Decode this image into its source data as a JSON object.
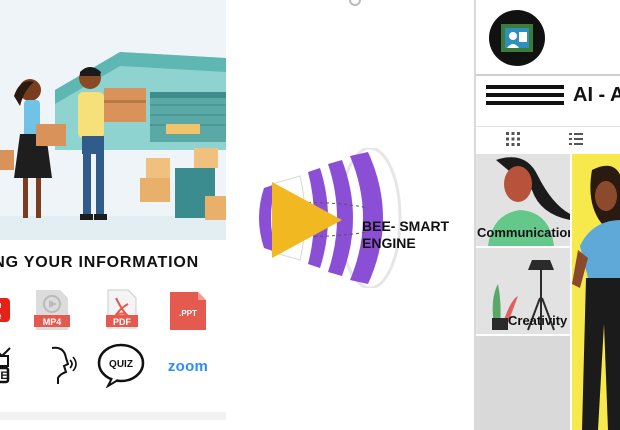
{
  "left_panel": {
    "caption": "ING YOUR INFORMATION",
    "formats": [
      {
        "name": "youtube-icon",
        "label": "u\nbe"
      },
      {
        "name": "mp4-file-icon",
        "label": "MP4"
      },
      {
        "name": "pdf-file-icon",
        "label": "PDF"
      },
      {
        "name": "ppt-file-icon",
        "label": ".PPT"
      },
      {
        "name": "live-icon",
        "label": "VE"
      },
      {
        "name": "voice-icon",
        "label": ""
      },
      {
        "name": "quiz-icon",
        "label": "QUIZ"
      },
      {
        "name": "zoom-logo",
        "label": "zoom"
      }
    ]
  },
  "engine": {
    "line1": "BEE- SMART",
    "line2": "ENGINE"
  },
  "phone": {
    "title": "AI - A",
    "cells": [
      {
        "label": "Communication"
      },
      {
        "label": ""
      },
      {
        "label": "Creativity"
      },
      {
        "label": ""
      },
      {
        "label": ""
      },
      {
        "label": ""
      }
    ]
  },
  "colors": {
    "engine_purple": "#8b4fd6",
    "play_yellow": "#f2b822",
    "cell_yellow": "#f7e94b",
    "cell_grey": "#d9d9d9",
    "file_red": "#e45a4e",
    "zoom_blue": "#2d8cff"
  }
}
